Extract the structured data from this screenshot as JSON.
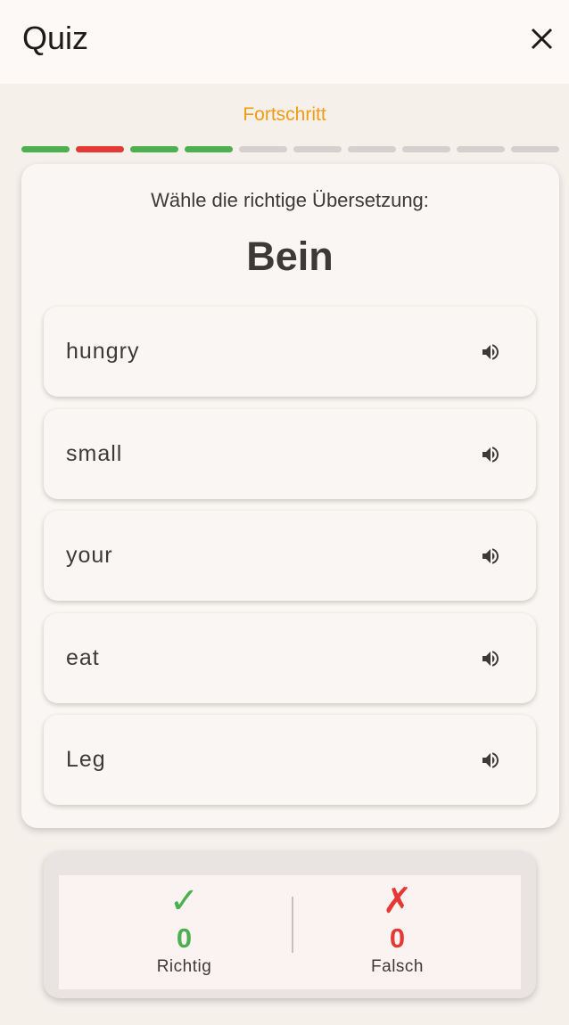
{
  "appbar": {
    "title": "Quiz",
    "close_icon": "close-icon"
  },
  "progress": {
    "label": "Fortschritt",
    "segments": [
      "correct",
      "wrong",
      "correct",
      "correct",
      "pending",
      "pending",
      "pending",
      "pending",
      "pending",
      "pending"
    ],
    "colors": {
      "correct": "#4caf50",
      "wrong": "#e53935",
      "pending": "#d4d0cd"
    }
  },
  "question": {
    "instruction": "Wähle die richtige Übersetzung:",
    "word": "Bein"
  },
  "options": [
    {
      "label": "hungry",
      "icon": "speaker-icon"
    },
    {
      "label": "small",
      "icon": "speaker-icon"
    },
    {
      "label": "your",
      "icon": "speaker-icon"
    },
    {
      "label": "eat",
      "icon": "speaker-icon"
    },
    {
      "label": "Leg",
      "icon": "speaker-icon"
    }
  ],
  "score": {
    "correct": {
      "icon": "✓",
      "count": "0",
      "label": "Richtig",
      "color": "#4caf50"
    },
    "wrong": {
      "icon": "✗",
      "count": "0",
      "label": "Falsch",
      "color": "#e53935"
    }
  },
  "colors": {
    "accent": "#f39a17",
    "text": "#3c3a39"
  }
}
